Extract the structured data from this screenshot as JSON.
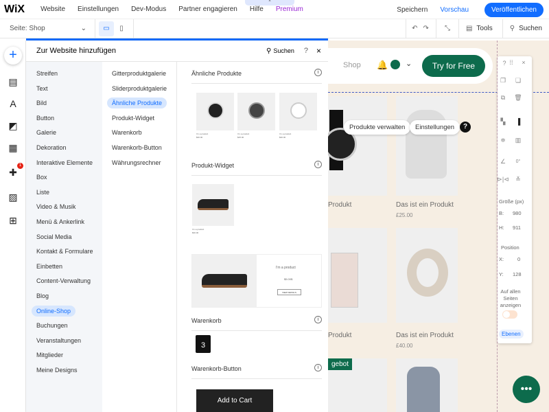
{
  "topbar": {
    "logo": "WiX",
    "menu": [
      "Website",
      "Einstellungen",
      "Dev-Modus",
      "Partner engagieren",
      "Hilfe",
      "Premium"
    ],
    "save": "Speichern",
    "preview": "Vorschau",
    "publish": "Veröffentlichen"
  },
  "toolbar": {
    "page_label": "Seite:",
    "page_value": "Shop",
    "tools": "Tools",
    "search": "Suchen"
  },
  "rail": {
    "badge": "1"
  },
  "panel": {
    "title": "Zur Website hinzufügen",
    "search": "Suchen",
    "help": "?",
    "categories": [
      "Streifen",
      "Text",
      "Bild",
      "Button",
      "Galerie",
      "Dekoration",
      "Interaktive Elemente",
      "Box",
      "Liste",
      "Video & Musik",
      "Menü & Ankerlink",
      "Social Media",
      "Kontakt & Formulare",
      "Einbetten",
      "Content-Verwaltung",
      "Blog",
      "Online-Shop",
      "Buchungen",
      "Veranstaltungen",
      "Mitglieder",
      "Meine Designs"
    ],
    "subcategories": [
      "Gitterproduktgalerie",
      "Sliderproduktgalerie",
      "Ähnliche Produkte",
      "Produkt-Widget",
      "Warenkorb",
      "Warenkorb-Button",
      "Währungsrechner"
    ],
    "sections": {
      "related": "Ähnliche Produkte",
      "widget": "Produkt-Widget",
      "cart": "Warenkorb",
      "cart_button": "Warenkorb-Button"
    },
    "sample": {
      "product": "I'm a product",
      "price1": "$30.00",
      "price2": "$25.00",
      "price3": "$30.00",
      "widget_price": "$5.00$",
      "widget_button": "VIEW DETAILS",
      "cart_count": "3",
      "add_to_cart": "Add to Cart"
    }
  },
  "canvas": {
    "nav_shop": "Shop",
    "try_free": "Try for Free",
    "manage_products": "Produkte verwalten",
    "settings": "Einstellungen",
    "products": [
      {
        "name": "Produkt",
        "price": ""
      },
      {
        "name": "Das ist ein Produkt",
        "price": "£25.00"
      },
      {
        "name": "Produkt",
        "price": ""
      },
      {
        "name": "Das ist ein Produkt",
        "price": "£40.00"
      }
    ],
    "badge": "gebot"
  },
  "float_panel": {
    "size_label": "Größe (px)",
    "w_label": "B:",
    "w": "980",
    "h_label": "H:",
    "h": "911",
    "position_label": "Position",
    "x_label": "X:",
    "x": "0",
    "y_label": "Y:",
    "y": "128",
    "rotation": "0°",
    "show_all": "Auf allen Seiten anzeigen",
    "layers": "Ebenen"
  }
}
